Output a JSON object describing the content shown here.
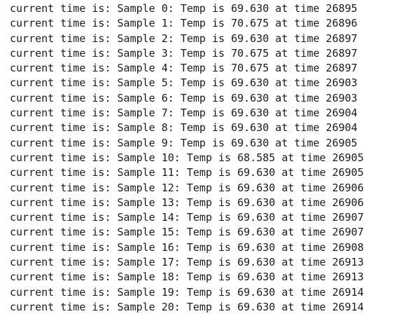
{
  "log": {
    "lines": [
      "current time is: Sample 0: Temp is 69.630 at time 26895",
      "current time is: Sample 1: Temp is 70.675 at time 26896",
      "current time is: Sample 2: Temp is 69.630 at time 26897",
      "current time is: Sample 3: Temp is 70.675 at time 26897",
      "current time is: Sample 4: Temp is 70.675 at time 26897",
      "current time is: Sample 5: Temp is 69.630 at time 26903",
      "current time is: Sample 6: Temp is 69.630 at time 26903",
      "current time is: Sample 7: Temp is 69.630 at time 26904",
      "current time is: Sample 8: Temp is 69.630 at time 26904",
      "current time is: Sample 9: Temp is 69.630 at time 26905",
      "current time is: Sample 10: Temp is 68.585 at time 26905",
      "current time is: Sample 11: Temp is 69.630 at time 26905",
      "current time is: Sample 12: Temp is 69.630 at time 26906",
      "current time is: Sample 13: Temp is 69.630 at time 26906",
      "current time is: Sample 14: Temp is 69.630 at time 26907",
      "current time is: Sample 15: Temp is 69.630 at time 26907",
      "current time is: Sample 16: Temp is 69.630 at time 26908",
      "current time is: Sample 17: Temp is 69.630 at time 26913",
      "current time is: Sample 18: Temp is 69.630 at time 26913",
      "current time is: Sample 19: Temp is 69.630 at time 26914",
      "current time is: Sample 20: Temp is 69.630 at time 26914"
    ]
  }
}
